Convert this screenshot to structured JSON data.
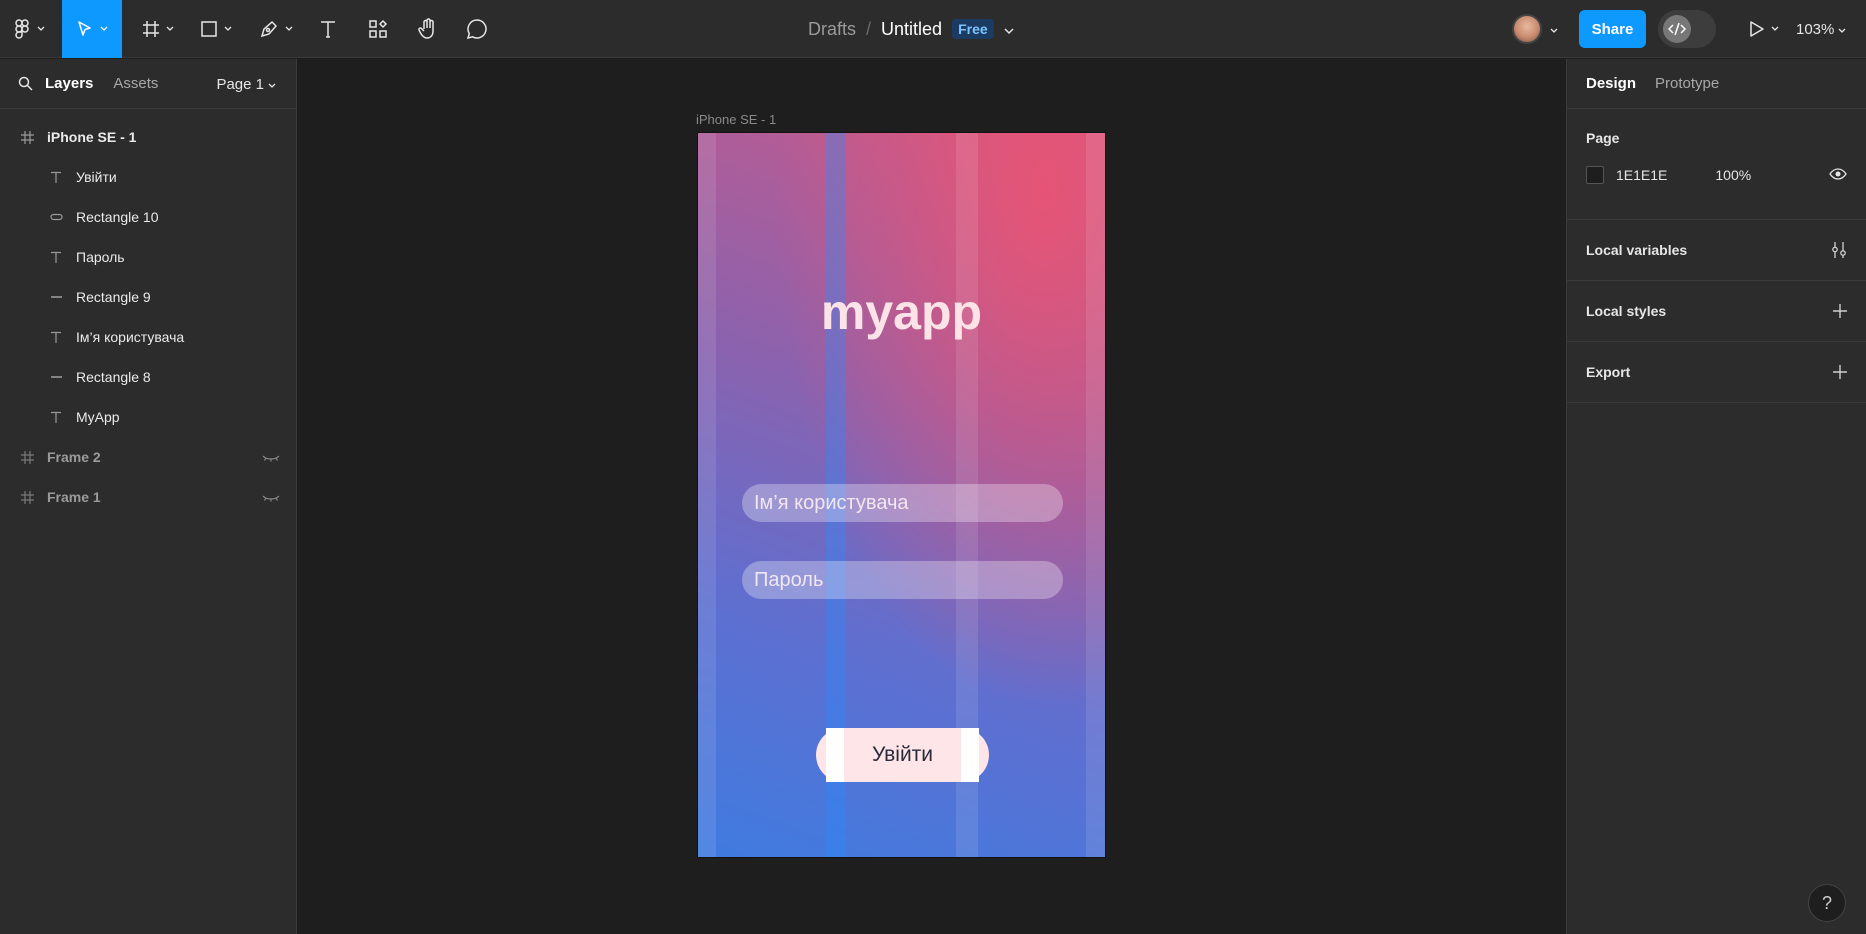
{
  "toolbar": {
    "breadcrumb": {
      "parent": "Drafts",
      "separator": "/",
      "file_name": "Untitled",
      "plan_badge": "Free"
    },
    "share_label": "Share",
    "zoom_level": "103%",
    "icons": [
      "figma-menu-icon",
      "move-tool-icon",
      "frame-tool-icon",
      "shape-tool-icon",
      "pen-tool-icon",
      "text-tool-icon",
      "resources-icon",
      "hand-tool-icon",
      "comment-icon",
      "dev-mode-icon",
      "present-icon"
    ],
    "accent_color": "#0d99ff"
  },
  "left_panel": {
    "tabs": [
      "Layers",
      "Assets"
    ],
    "page_selector": "Page 1",
    "layers": [
      {
        "name": "iPhone SE - 1",
        "type": "frame"
      },
      {
        "name": "Увійти",
        "type": "text"
      },
      {
        "name": "Rectangle 10",
        "type": "rectangle"
      },
      {
        "name": "Пароль",
        "type": "text"
      },
      {
        "name": "Rectangle 9",
        "type": "line"
      },
      {
        "name": "Ім’я користувача",
        "type": "text"
      },
      {
        "name": "Rectangle 8",
        "type": "line"
      },
      {
        "name": "MyApp",
        "type": "text"
      },
      {
        "name": "Frame 2",
        "type": "frame",
        "hidden": true
      },
      {
        "name": "Frame 1",
        "type": "frame",
        "hidden": true
      }
    ]
  },
  "canvas": {
    "frame_label": "iPhone SE - 1",
    "app": {
      "title": "myapp",
      "username_placeholder": "Ім’я користувача",
      "password_placeholder": "Пароль",
      "login_label": "Увійти"
    }
  },
  "right_panel": {
    "tabs": [
      "Design",
      "Prototype"
    ],
    "page_section": {
      "title": "Page",
      "color_hex": "1E1E1E",
      "opacity": "100%"
    },
    "sections": [
      "Local variables",
      "Local styles",
      "Export"
    ],
    "help_label": "?"
  }
}
